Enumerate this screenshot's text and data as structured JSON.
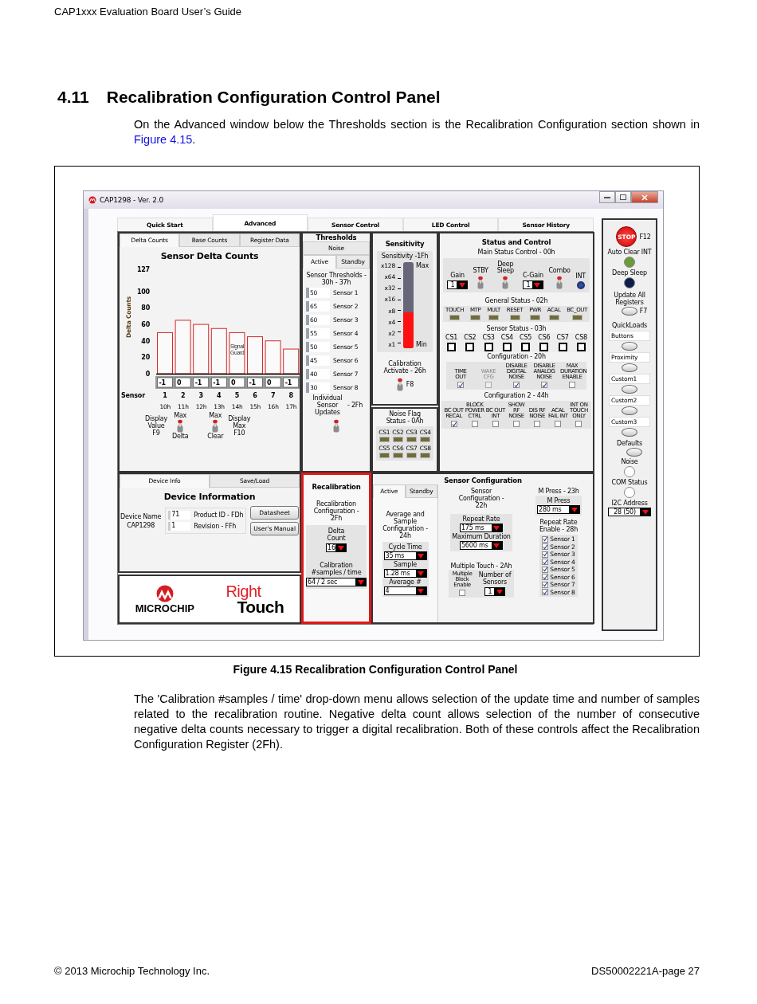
{
  "doc_header": "CAP1xxx Evaluation Board User’s Guide",
  "section": {
    "number": "4.11",
    "title": "Recalibration Configuration Control Panel"
  },
  "intro": {
    "text": "On the Advanced window below the Thresholds section is the Recalibration Configuration section shown in",
    "link": "Figure 4.15",
    "end": "."
  },
  "window": {
    "title": "CAP1298 - Ver.  2.0"
  },
  "main_tabs": [
    {
      "label": "Quick Start",
      "selected": false
    },
    {
      "label": "Advanced",
      "selected": true
    },
    {
      "label": "Sensor Control",
      "selected": false
    },
    {
      "label": "LED Control",
      "selected": false
    },
    {
      "label": "Sensor History",
      "selected": false
    }
  ],
  "delta_panel": {
    "tabs": [
      {
        "label": "Delta Counts",
        "selected": true
      },
      {
        "label": "Base Counts",
        "selected": false
      },
      {
        "label": "Register Data",
        "selected": false
      }
    ],
    "title": "Sensor Delta Counts",
    "chart_data": {
      "type": "bar",
      "ylabel": "Delta Counts",
      "categories": [
        "1",
        "2",
        "3",
        "4",
        "5",
        "6",
        "7",
        "8"
      ],
      "values": [
        50,
        65,
        60,
        55,
        50,
        45,
        40,
        30
      ],
      "ylim": [
        0,
        127
      ],
      "yticks": [
        0,
        20,
        40,
        60,
        80,
        100,
        127
      ]
    },
    "signal_guard": [
      "Signal",
      "Guard"
    ],
    "readings": [
      "-1",
      "0",
      "-1",
      "-1",
      "0",
      "-1",
      "0",
      "-1"
    ],
    "sensor_label": "Sensor",
    "registers": [
      "10h",
      "11h",
      "12h",
      "13h",
      "14h",
      "15h",
      "16h",
      "17h"
    ],
    "switches": [
      {
        "kind": "label-left",
        "top": "Max",
        "label": "Display Value F9",
        "bottom": "Delta",
        "on": false
      },
      {
        "kind": "label-right",
        "top": "Max",
        "label": "Display Max F10",
        "bottom": "Clear",
        "on": false
      }
    ]
  },
  "thresholds": {
    "title": "Thresholds",
    "tab_rows": [
      [
        {
          "label": "Noise",
          "selected": false
        }
      ],
      [
        {
          "label": "Active",
          "selected": true
        },
        {
          "label": "Standby",
          "selected": false
        }
      ]
    ],
    "subtitle": "Sensor Thresholds - 30h - 37h",
    "rows": [
      {
        "value": "50",
        "label": "Sensor 1"
      },
      {
        "value": "65",
        "label": "Sensor 2"
      },
      {
        "value": "60",
        "label": "Sensor 3"
      },
      {
        "value": "55",
        "label": "Sensor 4"
      },
      {
        "value": "50",
        "label": "Sensor 5"
      },
      {
        "value": "45",
        "label": "Sensor 6"
      },
      {
        "value": "40",
        "label": "Sensor 7"
      },
      {
        "value": "30",
        "label": "Sensor 8"
      }
    ],
    "updates_label": "Individual Sensor Updates",
    "updates_register": "- 2Fh",
    "updates_on": false
  },
  "sensitivity": {
    "title": "Sensitivity",
    "meter_label": "Sensitivity -1Fh",
    "scale": [
      "x128",
      "x64",
      "x32",
      "x16",
      "x8",
      "x4",
      "x2",
      "x1"
    ],
    "max": "Max",
    "min": "Min",
    "level": 0.42,
    "calibration": "Calibration Activate - 26h",
    "calibration_on": false,
    "key": "F8"
  },
  "noise_flag": {
    "title": "Noise Flag Status - 0Ah",
    "leds": [
      "CS1",
      "CS2",
      "CS3",
      "CS4",
      "CS5",
      "CS6",
      "CS7",
      "CS8"
    ]
  },
  "status": {
    "title": "Status and Control",
    "main_title": "Main Status Control -  00h",
    "controls": [
      {
        "kind": "dropdown",
        "label": "Gain",
        "value": "1"
      },
      {
        "kind": "toggle",
        "label": "STBY",
        "on": false
      },
      {
        "kind": "toggle",
        "label": "Deep Sleep",
        "on": false
      },
      {
        "kind": "dropdown",
        "label": "C-Gain",
        "value": "1"
      },
      {
        "kind": "toggle",
        "label": "Combo",
        "on": false
      },
      {
        "kind": "led",
        "label": "INT"
      }
    ],
    "general_title": "General Status -  02h",
    "general": [
      "TOUCH",
      "MTP",
      "MULT",
      "RESET",
      "PWR",
      "ACAL",
      "BC_OUT"
    ],
    "sensor_title": "Sensor Status - 03h",
    "sensors": [
      "CS1",
      "CS2",
      "CS3",
      "CS4",
      "CS5",
      "CS6",
      "CS7",
      "CS8"
    ],
    "config_title": "Configuration - 20h",
    "config": [
      {
        "label": "TIME OUT",
        "checked": true,
        "disabled": false
      },
      {
        "label": "WAKE CFG",
        "checked": false,
        "disabled": true
      },
      {
        "label": "DISABLE DIGITAL NOISE",
        "checked": true,
        "disabled": false
      },
      {
        "label": "DISABLE ANALOG NOISE",
        "checked": true,
        "disabled": false
      },
      {
        "label": "MAX DURATION ENABLE",
        "checked": false,
        "disabled": false
      }
    ],
    "config2_title": "Configuration 2 -  44h",
    "config2": [
      {
        "label": "BC OUT RECAL",
        "checked": true
      },
      {
        "label": "BLOCK POWER CTRL",
        "checked": false
      },
      {
        "label": "BC OUT INT",
        "checked": false
      },
      {
        "label": "SHOW RF NOISE",
        "checked": false
      },
      {
        "label": "DIS RF NOISE",
        "checked": false
      },
      {
        "label": "ACAL FAIL INT",
        "checked": false
      },
      {
        "label": "INT ON TOUCH ONLY",
        "checked": false
      }
    ]
  },
  "device": {
    "tabs": [
      {
        "label": "Device Info",
        "selected": true
      },
      {
        "label": "Save/Load",
        "selected": false
      }
    ],
    "title": "Device Information",
    "name_label": "Device Name",
    "name": "CAP1298",
    "fields": [
      {
        "value": "71",
        "label": "Product ID - FDh"
      },
      {
        "value": "1",
        "label": "Revision - FFh"
      }
    ],
    "buttons": [
      "Datasheet",
      "User's Manual"
    ]
  },
  "logos": {
    "company": "MICROCHIP",
    "brand_top": "Right",
    "brand_bottom": "Touch"
  },
  "recalibration": {
    "title": "Recalibration",
    "subtitle": "Recalibration Configuration - 2Fh",
    "delta_label": "Delta Count",
    "delta_value": "16",
    "cal_label": "Calibration #samples / time",
    "cal_value": "64 / 2 sec"
  },
  "sensor_config": {
    "title": "Sensor Configuration",
    "tabs": [
      {
        "label": "Active",
        "selected": true
      },
      {
        "label": "Standby",
        "selected": false
      }
    ],
    "avg_title": "Average and Sample Configuration - 24h",
    "avg": [
      {
        "label": "Cycle Time",
        "value": "35 ms"
      },
      {
        "label": "Sample",
        "value": "1.28 ms"
      },
      {
        "label": "Average #",
        "value": "4"
      }
    ],
    "cfg_title": "Sensor Configuration - 22h",
    "cfg": [
      {
        "label": "Repeat Rate",
        "value": "175 ms"
      },
      {
        "label": "Maximum Duration",
        "value": "5600 ms"
      }
    ],
    "multi_title": "Multiple Touch - 2Ah",
    "multi_block": {
      "label": "Multiple Block Enable",
      "checked": false
    },
    "num_label": "Number of Sensors",
    "num_value": "1",
    "mpress_title": "M Press - 23h",
    "mpress_label": "M Press",
    "mpress_value": "280 ms",
    "repeat_title": "Repeat Rate Enable - 28h",
    "repeat": [
      {
        "label": "Sensor 1",
        "checked": true
      },
      {
        "label": "Sensor 2",
        "checked": true
      },
      {
        "label": "Sensor 3",
        "checked": true
      },
      {
        "label": "Sensor 4",
        "checked": true
      },
      {
        "label": "Sensor 5",
        "checked": true
      },
      {
        "label": "Sensor 6",
        "checked": true
      },
      {
        "label": "Sensor 7",
        "checked": true
      },
      {
        "label": "Sensor 8",
        "checked": true
      }
    ]
  },
  "sidebar": [
    {
      "kind": "stop",
      "label": "STOP",
      "key": "F12"
    },
    {
      "kind": "led",
      "label": "Auto Clear INT",
      "color": "#6a9a3a"
    },
    {
      "kind": "led",
      "label": "Deep Sleep",
      "color": "#0c1d4a"
    },
    {
      "kind": "button",
      "label": "Update All Registers",
      "key": "F7"
    },
    {
      "kind": "heading",
      "label": "QuickLoads"
    },
    {
      "kind": "preset",
      "value": "Buttons"
    },
    {
      "kind": "preset",
      "value": "Proximity"
    },
    {
      "kind": "preset",
      "value": "Custom1"
    },
    {
      "kind": "preset",
      "value": "Custom2"
    },
    {
      "kind": "preset",
      "value": "Custom3"
    },
    {
      "kind": "button",
      "label": "Defaults"
    },
    {
      "kind": "led",
      "label": "Noise",
      "color": "#ffffff"
    },
    {
      "kind": "led",
      "label": "COM Status",
      "color": "#ffffff"
    },
    {
      "kind": "dropdown",
      "label": "I2C Address",
      "value": "28 (50)"
    }
  ],
  "caption": "Figure 4.15 Recalibration Configuration Control Panel",
  "body": "The 'Calibration #samples / time' drop-down menu allows selection of the update time and number of samples related to the recalibration routine. Negative delta count allows selection of the number of consecutive negative delta counts necessary to trigger a digital recalibration. Both of these controls affect the Recalibration Configuration Register (2Fh).",
  "footer": {
    "left": "© 2013 Microchip Technology Inc.",
    "right": "DS50002221A-page 27"
  }
}
